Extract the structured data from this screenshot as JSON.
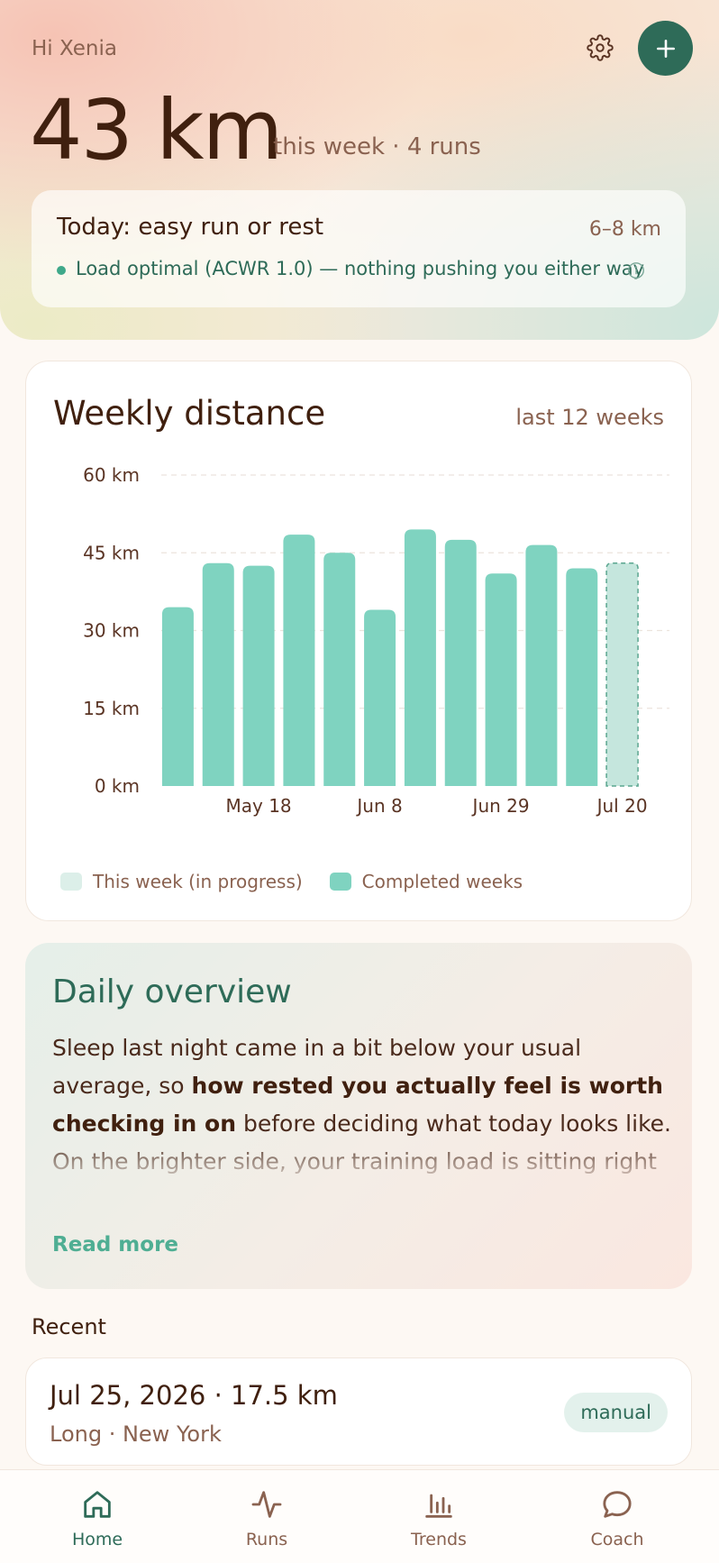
{
  "header": {
    "greeting": "Hi Xenia",
    "settings_icon": "gear-icon",
    "add_icon": "plus-icon",
    "distance": "43 km",
    "subtitle": "this week · 4 runs"
  },
  "today": {
    "title": "Today: easy run or rest",
    "range": "6–8 km",
    "status": "Load optimal (ACWR 1.0) — nothing pushing you either way",
    "status_color": "#3fa98a",
    "info_icon": "info-icon"
  },
  "chart_section": {
    "title": "Weekly distance",
    "range_label": "last 12 weeks",
    "legend": {
      "in_progress": "This week (in progress)",
      "completed": "Completed weeks"
    }
  },
  "chart_data": {
    "type": "bar",
    "title": "Weekly distance",
    "subtitle": "last 12 weeks",
    "y_ticks": [
      "0 km",
      "15 km",
      "30 km",
      "45 km",
      "60 km"
    ],
    "ylim": [
      0,
      60
    ],
    "x_tick_labels": [
      {
        "index": 2,
        "label": "May 18"
      },
      {
        "index": 5,
        "label": "Jun 8"
      },
      {
        "index": 8,
        "label": "Jun 29"
      },
      {
        "index": 11,
        "label": "Jul 20"
      }
    ],
    "values": [
      34.5,
      43,
      42.5,
      48.5,
      45,
      34,
      49.5,
      47.5,
      41,
      46.5,
      42,
      43
    ],
    "in_progress_index": 11,
    "grid": true,
    "colors": {
      "completed": "#7fd3c0",
      "in_progress": "#c5e6dd",
      "in_progress_border": "#5aa58f"
    }
  },
  "overview": {
    "title": "Daily overview",
    "text_pre": "Sleep last night came in a bit below your usual average, so ",
    "text_bold": "how rested you actually feel is worth checking in on",
    "text_post": " before deciding what today looks like. On the brighter side, your training load is sitting right in the optimal range and it's been four days since your last hard effort,",
    "read_more": "Read more"
  },
  "recent": {
    "label": "Recent",
    "items": [
      {
        "title": "Jul 25, 2026 · 17.5 km",
        "subtitle": "Long · New York",
        "badge": "manual"
      }
    ]
  },
  "tabs": [
    {
      "label": "Home",
      "icon": "home-icon",
      "active": true
    },
    {
      "label": "Runs",
      "icon": "activity-icon",
      "active": false
    },
    {
      "label": "Trends",
      "icon": "bar-chart-icon",
      "active": false
    },
    {
      "label": "Coach",
      "icon": "chat-bubble-icon",
      "active": false
    }
  ],
  "colors": {
    "accent": "#2e6b58",
    "accent_light": "#4fae93",
    "text_primary": "#40200f",
    "text_secondary": "#8a6250"
  }
}
